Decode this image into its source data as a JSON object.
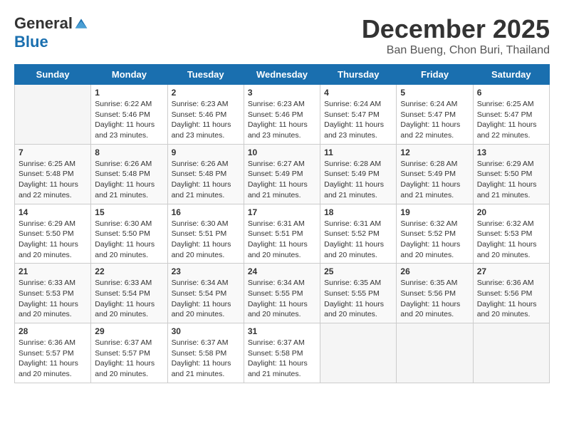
{
  "header": {
    "logo_general": "General",
    "logo_blue": "Blue",
    "title": "December 2025",
    "location": "Ban Bueng, Chon Buri, Thailand"
  },
  "calendar": {
    "days_of_week": [
      "Sunday",
      "Monday",
      "Tuesday",
      "Wednesday",
      "Thursday",
      "Friday",
      "Saturday"
    ],
    "weeks": [
      [
        {
          "day": "",
          "info": ""
        },
        {
          "day": "1",
          "info": "Sunrise: 6:22 AM\nSunset: 5:46 PM\nDaylight: 11 hours\nand 23 minutes."
        },
        {
          "day": "2",
          "info": "Sunrise: 6:23 AM\nSunset: 5:46 PM\nDaylight: 11 hours\nand 23 minutes."
        },
        {
          "day": "3",
          "info": "Sunrise: 6:23 AM\nSunset: 5:46 PM\nDaylight: 11 hours\nand 23 minutes."
        },
        {
          "day": "4",
          "info": "Sunrise: 6:24 AM\nSunset: 5:47 PM\nDaylight: 11 hours\nand 23 minutes."
        },
        {
          "day": "5",
          "info": "Sunrise: 6:24 AM\nSunset: 5:47 PM\nDaylight: 11 hours\nand 22 minutes."
        },
        {
          "day": "6",
          "info": "Sunrise: 6:25 AM\nSunset: 5:47 PM\nDaylight: 11 hours\nand 22 minutes."
        }
      ],
      [
        {
          "day": "7",
          "info": "Sunrise: 6:25 AM\nSunset: 5:48 PM\nDaylight: 11 hours\nand 22 minutes."
        },
        {
          "day": "8",
          "info": "Sunrise: 6:26 AM\nSunset: 5:48 PM\nDaylight: 11 hours\nand 21 minutes."
        },
        {
          "day": "9",
          "info": "Sunrise: 6:26 AM\nSunset: 5:48 PM\nDaylight: 11 hours\nand 21 minutes."
        },
        {
          "day": "10",
          "info": "Sunrise: 6:27 AM\nSunset: 5:49 PM\nDaylight: 11 hours\nand 21 minutes."
        },
        {
          "day": "11",
          "info": "Sunrise: 6:28 AM\nSunset: 5:49 PM\nDaylight: 11 hours\nand 21 minutes."
        },
        {
          "day": "12",
          "info": "Sunrise: 6:28 AM\nSunset: 5:49 PM\nDaylight: 11 hours\nand 21 minutes."
        },
        {
          "day": "13",
          "info": "Sunrise: 6:29 AM\nSunset: 5:50 PM\nDaylight: 11 hours\nand 21 minutes."
        }
      ],
      [
        {
          "day": "14",
          "info": "Sunrise: 6:29 AM\nSunset: 5:50 PM\nDaylight: 11 hours\nand 20 minutes."
        },
        {
          "day": "15",
          "info": "Sunrise: 6:30 AM\nSunset: 5:50 PM\nDaylight: 11 hours\nand 20 minutes."
        },
        {
          "day": "16",
          "info": "Sunrise: 6:30 AM\nSunset: 5:51 PM\nDaylight: 11 hours\nand 20 minutes."
        },
        {
          "day": "17",
          "info": "Sunrise: 6:31 AM\nSunset: 5:51 PM\nDaylight: 11 hours\nand 20 minutes."
        },
        {
          "day": "18",
          "info": "Sunrise: 6:31 AM\nSunset: 5:52 PM\nDaylight: 11 hours\nand 20 minutes."
        },
        {
          "day": "19",
          "info": "Sunrise: 6:32 AM\nSunset: 5:52 PM\nDaylight: 11 hours\nand 20 minutes."
        },
        {
          "day": "20",
          "info": "Sunrise: 6:32 AM\nSunset: 5:53 PM\nDaylight: 11 hours\nand 20 minutes."
        }
      ],
      [
        {
          "day": "21",
          "info": "Sunrise: 6:33 AM\nSunset: 5:53 PM\nDaylight: 11 hours\nand 20 minutes."
        },
        {
          "day": "22",
          "info": "Sunrise: 6:33 AM\nSunset: 5:54 PM\nDaylight: 11 hours\nand 20 minutes."
        },
        {
          "day": "23",
          "info": "Sunrise: 6:34 AM\nSunset: 5:54 PM\nDaylight: 11 hours\nand 20 minutes."
        },
        {
          "day": "24",
          "info": "Sunrise: 6:34 AM\nSunset: 5:55 PM\nDaylight: 11 hours\nand 20 minutes."
        },
        {
          "day": "25",
          "info": "Sunrise: 6:35 AM\nSunset: 5:55 PM\nDaylight: 11 hours\nand 20 minutes."
        },
        {
          "day": "26",
          "info": "Sunrise: 6:35 AM\nSunset: 5:56 PM\nDaylight: 11 hours\nand 20 minutes."
        },
        {
          "day": "27",
          "info": "Sunrise: 6:36 AM\nSunset: 5:56 PM\nDaylight: 11 hours\nand 20 minutes."
        }
      ],
      [
        {
          "day": "28",
          "info": "Sunrise: 6:36 AM\nSunset: 5:57 PM\nDaylight: 11 hours\nand 20 minutes."
        },
        {
          "day": "29",
          "info": "Sunrise: 6:37 AM\nSunset: 5:57 PM\nDaylight: 11 hours\nand 20 minutes."
        },
        {
          "day": "30",
          "info": "Sunrise: 6:37 AM\nSunset: 5:58 PM\nDaylight: 11 hours\nand 21 minutes."
        },
        {
          "day": "31",
          "info": "Sunrise: 6:37 AM\nSunset: 5:58 PM\nDaylight: 11 hours\nand 21 minutes."
        },
        {
          "day": "",
          "info": ""
        },
        {
          "day": "",
          "info": ""
        },
        {
          "day": "",
          "info": ""
        }
      ]
    ]
  }
}
